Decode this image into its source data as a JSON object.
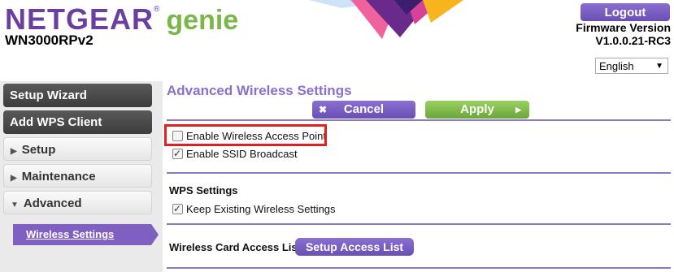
{
  "header": {
    "brand_netgear": "NETGEAR",
    "brand_genie": "genie",
    "model": "WN3000RPv2",
    "logout_label": "Logout",
    "firmware_label": "Firmware Version",
    "firmware_value": "V1.0.0.21-RC3",
    "language_selected": "English"
  },
  "sidebar": {
    "items": [
      {
        "label": "Setup Wizard"
      },
      {
        "label": "Add WPS Client"
      },
      {
        "label": "Setup"
      },
      {
        "label": "Maintenance"
      },
      {
        "label": "Advanced"
      }
    ],
    "sub_item": "Wireless Settings"
  },
  "main": {
    "title": "Advanced Wireless Settings",
    "cancel_label": "Cancel",
    "apply_label": "Apply",
    "enable_ap_label": "Enable Wireless Access Point",
    "enable_ap_checked": false,
    "enable_ssid_label": "Enable SSID Broadcast",
    "enable_ssid_checked": true,
    "wps_section": "WPS Settings",
    "keep_wireless_label": "Keep Existing Wireless Settings",
    "keep_wireless_checked": true,
    "card_access_label": "Wireless Card Access List",
    "setup_access_list_label": "Setup Access List"
  },
  "colors": {
    "accent_purple": "#6b3fa0",
    "button_purple": "#7b5fc4",
    "apply_green": "#7ab648",
    "highlight_red": "#e0221e"
  }
}
